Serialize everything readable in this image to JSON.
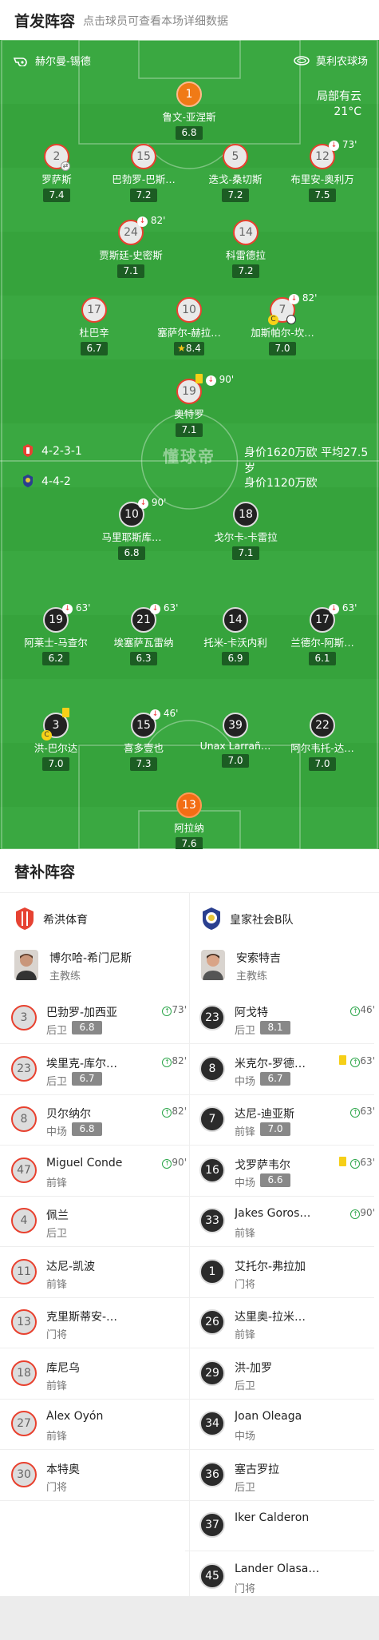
{
  "header": {
    "title": "首发阵容",
    "subtitle": "点击球员可查看本场详细数据"
  },
  "venue": {
    "referee": "赫尔曼-锡德",
    "stadium": "莫利农球场"
  },
  "weather": {
    "label": "局部有云",
    "temp": "21°C"
  },
  "home": {
    "formation": "4-2-3-1",
    "value": "身价1620万欧",
    "age": "平均27.5岁"
  },
  "away": {
    "formation": "4-4-2",
    "value": "身价1120万欧"
  },
  "watermark": "懂球帝",
  "home_players": [
    {
      "num": "1",
      "name": "鲁文-亚涅斯",
      "rating": "6.8"
    },
    {
      "num": "2",
      "name": "罗萨斯",
      "rating": "7.4"
    },
    {
      "num": "15",
      "name": "巴勃罗-巴斯…",
      "rating": "7.2"
    },
    {
      "num": "5",
      "name": "迭戈-桑切斯",
      "rating": "7.2"
    },
    {
      "num": "12",
      "name": "布里安-奥利万",
      "rating": "7.5",
      "event": "73'"
    },
    {
      "num": "24",
      "name": "贾斯廷-史密斯",
      "rating": "7.1",
      "event": "82'"
    },
    {
      "num": "14",
      "name": "科雷德拉",
      "rating": "7.2"
    },
    {
      "num": "17",
      "name": "杜巴辛",
      "rating": "6.7"
    },
    {
      "num": "10",
      "name": "塞萨尔-赫拉…",
      "rating": "8.4"
    },
    {
      "num": "7",
      "name": "加斯帕尔-坎…",
      "rating": "7.0",
      "event": "82'"
    },
    {
      "num": "19",
      "name": "奥特罗",
      "rating": "7.1",
      "event": "90'"
    }
  ],
  "away_players": [
    {
      "num": "10",
      "name": "马里耶斯库…",
      "rating": "6.8",
      "event": "90'"
    },
    {
      "num": "18",
      "name": "戈尔卡-卡雷拉",
      "rating": "7.1"
    },
    {
      "num": "19",
      "name": "阿莱士-马查尔",
      "rating": "6.2",
      "event": "63'"
    },
    {
      "num": "21",
      "name": "埃塞萨瓦雷纳",
      "rating": "6.3",
      "event": "63'"
    },
    {
      "num": "14",
      "name": "托米-卡沃内利",
      "rating": "6.9"
    },
    {
      "num": "17",
      "name": "兰德尔-阿斯…",
      "rating": "6.1",
      "event": "63'"
    },
    {
      "num": "3",
      "name": "洪-巴尔达",
      "rating": "7.0"
    },
    {
      "num": "15",
      "name": "喜多壹也",
      "rating": "7.3",
      "event": "46'"
    },
    {
      "num": "39",
      "name": "Unax Larrañ…",
      "rating": "7.0"
    },
    {
      "num": "22",
      "name": "阿尔韦托-达…",
      "rating": "7.0"
    },
    {
      "num": "13",
      "name": "阿拉纳",
      "rating": "7.6"
    }
  ],
  "subs": {
    "title": "替补阵容",
    "home_team": "希洪体育",
    "away_team": "皇家社会B队",
    "home_coach": {
      "name": "博尔哈-希门尼斯",
      "role": "主教练"
    },
    "away_coach": {
      "name": "安索特吉",
      "role": "主教练"
    },
    "home": [
      {
        "num": "3",
        "name": "巴勃罗-加西亚",
        "pos": "后卫",
        "rating": "6.8",
        "time": "73'"
      },
      {
        "num": "23",
        "name": "埃里克-库尔…",
        "pos": "后卫",
        "rating": "6.7",
        "time": "82'"
      },
      {
        "num": "8",
        "name": "贝尔纳尔",
        "pos": "中场",
        "rating": "6.8",
        "time": "82'"
      },
      {
        "num": "47",
        "name": "Miguel Conde",
        "pos": "前锋",
        "time": "90'"
      },
      {
        "num": "4",
        "name": "佩兰",
        "pos": "后卫"
      },
      {
        "num": "11",
        "name": "达尼-凯波",
        "pos": "前锋"
      },
      {
        "num": "13",
        "name": "克里斯蒂安-…",
        "pos": "门将"
      },
      {
        "num": "18",
        "name": "库尼乌",
        "pos": "前锋"
      },
      {
        "num": "27",
        "name": "Álex Oyón",
        "pos": "前锋"
      },
      {
        "num": "30",
        "name": "本特奥",
        "pos": "门将"
      }
    ],
    "away": [
      {
        "num": "23",
        "name": "阿戈特",
        "pos": "后卫",
        "rating": "8.1",
        "time": "46'"
      },
      {
        "num": "8",
        "name": "米克尔-罗德…",
        "pos": "中场",
        "rating": "6.7",
        "time": "63'"
      },
      {
        "num": "7",
        "name": "达尼-迪亚斯",
        "pos": "前锋",
        "rating": "7.0",
        "time": "63'"
      },
      {
        "num": "16",
        "name": "戈罗萨韦尔",
        "pos": "中场",
        "rating": "6.6",
        "time": "63'"
      },
      {
        "num": "33",
        "name": "Jakes Goros…",
        "pos": "前锋",
        "time": "90'"
      },
      {
        "num": "1",
        "name": "艾托尔-弗拉加",
        "pos": "门将"
      },
      {
        "num": "26",
        "name": "达里奥-拉米…",
        "pos": "前锋"
      },
      {
        "num": "29",
        "name": "洪-加罗",
        "pos": "后卫"
      },
      {
        "num": "34",
        "name": "Joan Oleaga",
        "pos": "中场"
      },
      {
        "num": "36",
        "name": "塞古罗拉",
        "pos": "后卫"
      },
      {
        "num": "37",
        "name": "Iker Calderon",
        "pos": ""
      },
      {
        "num": "45",
        "name": "Lander Olasa…",
        "pos": "门将"
      }
    ]
  },
  "colors": {
    "pitch": "#36a33c",
    "home_ring": "#e8412f",
    "keeper": "#f07a16",
    "rating_bg": "#1c5d23"
  }
}
